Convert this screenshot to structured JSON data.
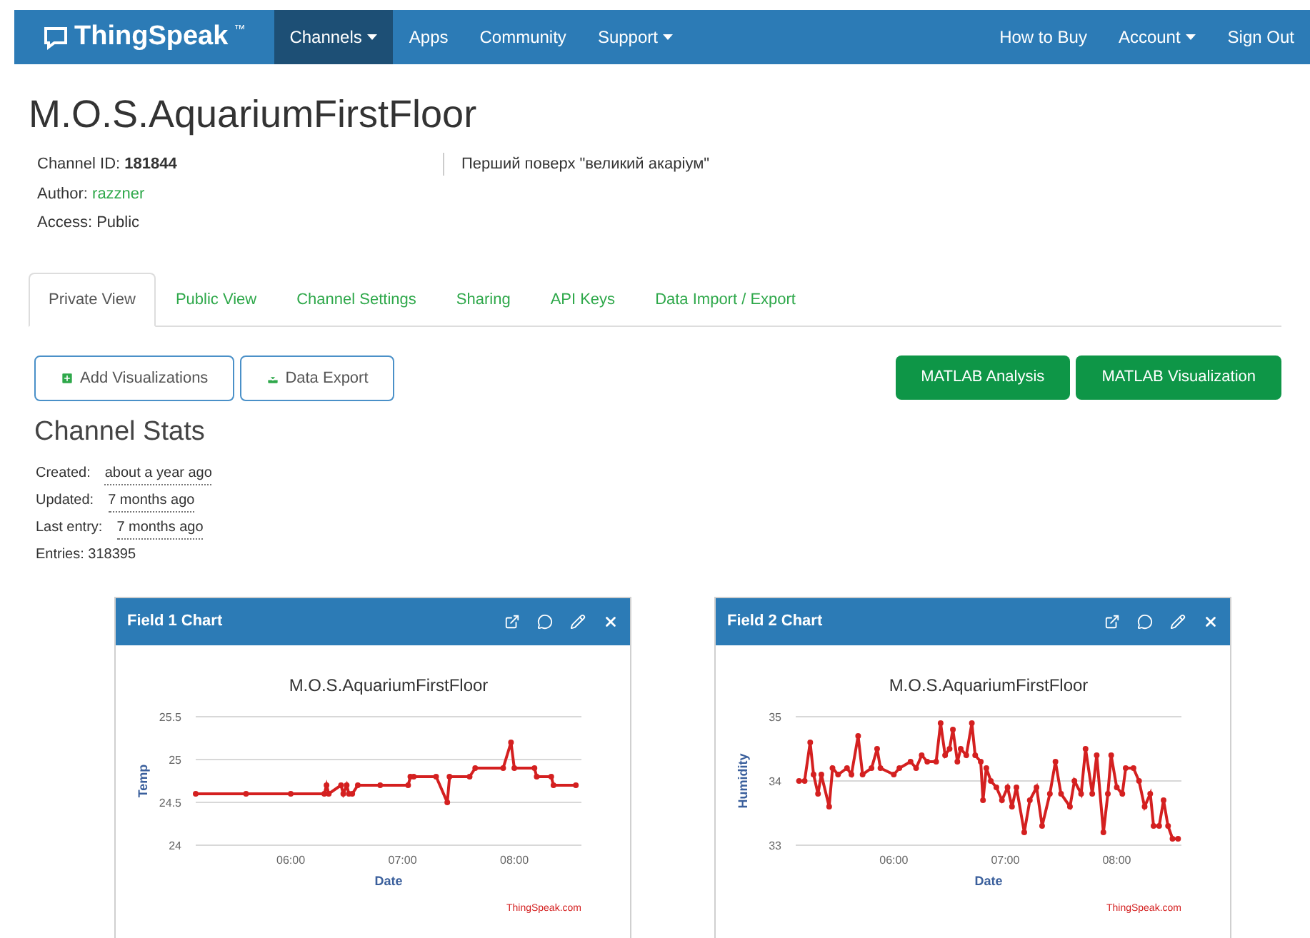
{
  "navbar": {
    "brand": "ThingSpeak",
    "trademark": "™",
    "left_items": [
      {
        "label": "Channels",
        "dropdown": true,
        "selected": true
      },
      {
        "label": "Apps",
        "dropdown": false,
        "selected": false
      },
      {
        "label": "Community",
        "dropdown": false,
        "selected": false
      },
      {
        "label": "Support",
        "dropdown": true,
        "selected": false
      }
    ],
    "right_items": [
      {
        "label": "How to Buy",
        "dropdown": false
      },
      {
        "label": "Account",
        "dropdown": true
      },
      {
        "label": "Sign Out",
        "dropdown": false
      }
    ]
  },
  "channel": {
    "title": "M.O.S.AquariumFirstFloor",
    "id_label": "Channel ID:",
    "id": "181844",
    "author_label": "Author:",
    "author": "razzner",
    "access": "Access: Public",
    "description": "Перший поверх \"великий акаріум\""
  },
  "tabs": [
    {
      "label": "Private View",
      "selected": true
    },
    {
      "label": "Public View",
      "selected": false
    },
    {
      "label": "Channel Settings",
      "selected": false
    },
    {
      "label": "Sharing",
      "selected": false
    },
    {
      "label": "API Keys",
      "selected": false
    },
    {
      "label": "Data Import / Export",
      "selected": false
    }
  ],
  "actions": [
    {
      "label": "Add Visualizations",
      "kind": "outline"
    },
    {
      "label": "Data Export",
      "kind": "outline"
    },
    {
      "label": "MATLAB Analysis",
      "kind": "solid"
    },
    {
      "label": "MATLAB Visualization",
      "kind": "solid"
    }
  ],
  "stats": {
    "title": "Channel Stats",
    "rows": [
      {
        "label": "Created:",
        "value": "about a year ago"
      },
      {
        "label": "Updated:",
        "value": "7 months ago"
      },
      {
        "label": "Last entry:",
        "value": "7 months ago"
      },
      {
        "label": "Entries: 318395"
      }
    ]
  },
  "charts": [
    {
      "header": "Field 1 Chart",
      "credit": "ThingSpeak.com",
      "chart_data": {
        "type": "line",
        "title": "M.O.S.AquariumFirstFloor",
        "xlabel": "Date",
        "ylabel": "Temp",
        "xlim": [
          5.15,
          8.6
        ],
        "ylim": [
          24,
          25.5
        ],
        "yticks": [
          {
            "value": 24,
            "label": "24"
          },
          {
            "value": 24.5,
            "label": "24.5"
          },
          {
            "value": 25,
            "label": "25"
          },
          {
            "value": 25.5,
            "label": "25.5"
          }
        ],
        "xticks": [
          {
            "value": 6,
            "label": "06:00"
          },
          {
            "value": 7,
            "label": "07:00"
          },
          {
            "value": 8,
            "label": "08:00"
          }
        ],
        "x": [
          5.15,
          5.6,
          6.0,
          6.3,
          6.32,
          6.34,
          6.45,
          6.47,
          6.5,
          6.52,
          6.55,
          6.6,
          6.8,
          7.05,
          7.07,
          7.1,
          7.3,
          7.4,
          7.42,
          7.6,
          7.65,
          7.9,
          7.97,
          8.0,
          8.18,
          8.2,
          8.33,
          8.35,
          8.55
        ],
        "series": [
          {
            "marker": true,
            "color": "#d42020",
            "values": [
              24.6,
              24.6,
              24.6,
              24.6,
              24.7,
              24.6,
              24.7,
              24.6,
              24.7,
              24.6,
              24.6,
              24.7,
              24.7,
              24.7,
              24.8,
              24.8,
              24.8,
              24.5,
              24.8,
              24.8,
              24.9,
              24.9,
              25.2,
              24.9,
              24.9,
              24.8,
              24.8,
              24.7,
              24.7
            ]
          }
        ]
      }
    },
    {
      "header": "Field 2 Chart",
      "credit": "ThingSpeak.com",
      "chart_data": {
        "type": "line",
        "title": "M.O.S.AquariumFirstFloor",
        "xlabel": "Date",
        "ylabel": "Humidity",
        "xlim": [
          5.12,
          8.58
        ],
        "ylim": [
          33,
          35
        ],
        "yticks": [
          {
            "value": 33,
            "label": "33"
          },
          {
            "value": 34,
            "label": "34"
          },
          {
            "value": 35,
            "label": "35"
          }
        ],
        "xticks": [
          {
            "value": 6,
            "label": "06:00"
          },
          {
            "value": 7,
            "label": "07:00"
          },
          {
            "value": 8,
            "label": "08:00"
          }
        ],
        "x": [
          5.15,
          5.2,
          5.25,
          5.28,
          5.32,
          5.35,
          5.42,
          5.45,
          5.5,
          5.58,
          5.62,
          5.68,
          5.72,
          5.8,
          5.85,
          5.88,
          6.0,
          6.05,
          6.15,
          6.2,
          6.25,
          6.3,
          6.38,
          6.42,
          6.46,
          6.5,
          6.53,
          6.57,
          6.6,
          6.65,
          6.7,
          6.73,
          6.78,
          6.8,
          6.83,
          6.87,
          6.92,
          6.97,
          7.02,
          7.06,
          7.1,
          7.17,
          7.22,
          7.28,
          7.33,
          7.4,
          7.45,
          7.5,
          7.58,
          7.62,
          7.68,
          7.72,
          7.78,
          7.82,
          7.88,
          7.92,
          7.95,
          8.0,
          8.05,
          8.08,
          8.15,
          8.2,
          8.25,
          8.3,
          8.33,
          8.38,
          8.42,
          8.46,
          8.5,
          8.55
        ],
        "series": [
          {
            "marker": true,
            "color": "#d42020",
            "values": [
              34.0,
              34.0,
              34.6,
              34.1,
              33.8,
              34.1,
              33.6,
              34.2,
              34.1,
              34.2,
              34.1,
              34.7,
              34.1,
              34.2,
              34.5,
              34.2,
              34.1,
              34.2,
              34.3,
              34.2,
              34.4,
              34.3,
              34.3,
              34.9,
              34.4,
              34.5,
              34.8,
              34.3,
              34.5,
              34.4,
              34.9,
              34.4,
              34.3,
              33.7,
              34.2,
              34.0,
              33.9,
              33.7,
              33.9,
              33.6,
              33.9,
              33.2,
              33.7,
              33.9,
              33.3,
              33.8,
              34.3,
              33.8,
              33.6,
              34.0,
              33.8,
              34.5,
              33.8,
              34.4,
              33.2,
              33.8,
              34.4,
              33.9,
              33.8,
              34.2,
              34.2,
              34.0,
              33.6,
              33.8,
              33.3,
              33.3,
              33.7,
              33.3,
              33.1,
              33.1
            ]
          }
        ]
      }
    }
  ]
}
